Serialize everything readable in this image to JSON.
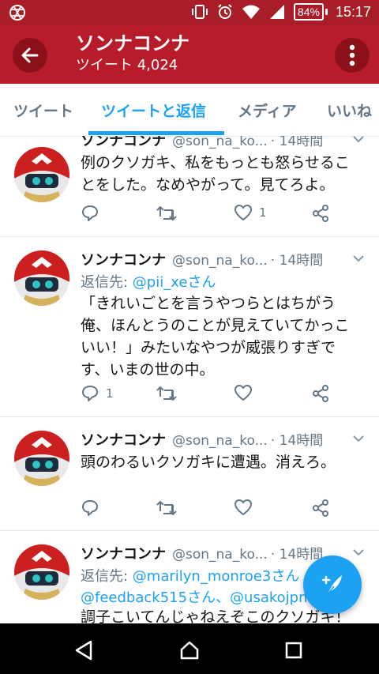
{
  "status_bar": {
    "time": "15:17",
    "battery": "84%",
    "icons": [
      "vibrate-icon",
      "alarm-icon",
      "wifi-icon",
      "signal-icon"
    ]
  },
  "app_bar": {
    "title": "ソンナコンナ",
    "subtitle": "ツイート 4,024"
  },
  "tabs": [
    {
      "label": "ツイート"
    },
    {
      "label": "ツイートと返信"
    },
    {
      "label": "メディア"
    },
    {
      "label": "いいね"
    }
  ],
  "tweets": [
    {
      "name": "ソンナコンナ",
      "handle": "@son_na_ko...",
      "time": "· 14時間",
      "lines": [
        "例のクソガキ、私をもっとも怒らせるこ",
        "とをした。なめやがって。見てろよ。"
      ],
      "reply_count": "",
      "like_count": "1"
    },
    {
      "name": "ソンナコンナ",
      "handle": "@son_na_ko...",
      "time": "· 14時間",
      "reply_prefix": "返信先: ",
      "reply_mentions": "@pii_xeさん",
      "lines": [
        "「きれいごとを言うやつらとはちがう",
        "俺、ほんとうのことが見えていてかっこ",
        "いい！」みたいなやつが威張りすぎで",
        "す、いまの世の中。"
      ],
      "reply_count": "1",
      "like_count": ""
    },
    {
      "name": "ソンナコンナ",
      "handle": "@son_na_ko...",
      "time": "· 14時間",
      "lines": [
        "頭のわるいクソガキに遭遇。消えろ。"
      ],
      "reply_count": "",
      "like_count": ""
    },
    {
      "name": "ソンナコンナ",
      "handle": "@son_na_ko...",
      "time": "· 14時間",
      "reply_prefix": "返信先: ",
      "reply_mentions": "@marilyn_monroe3さん",
      "reply_mentions_2": "@feedback515さん、@usakojpn",
      "lines": [
        "調子こいてんじゃねえぞこのクソガキ！"
      ]
    }
  ],
  "colors": {
    "brand": "#b71c2a",
    "accent": "#1da1f2",
    "secondary_text": "#657786"
  }
}
